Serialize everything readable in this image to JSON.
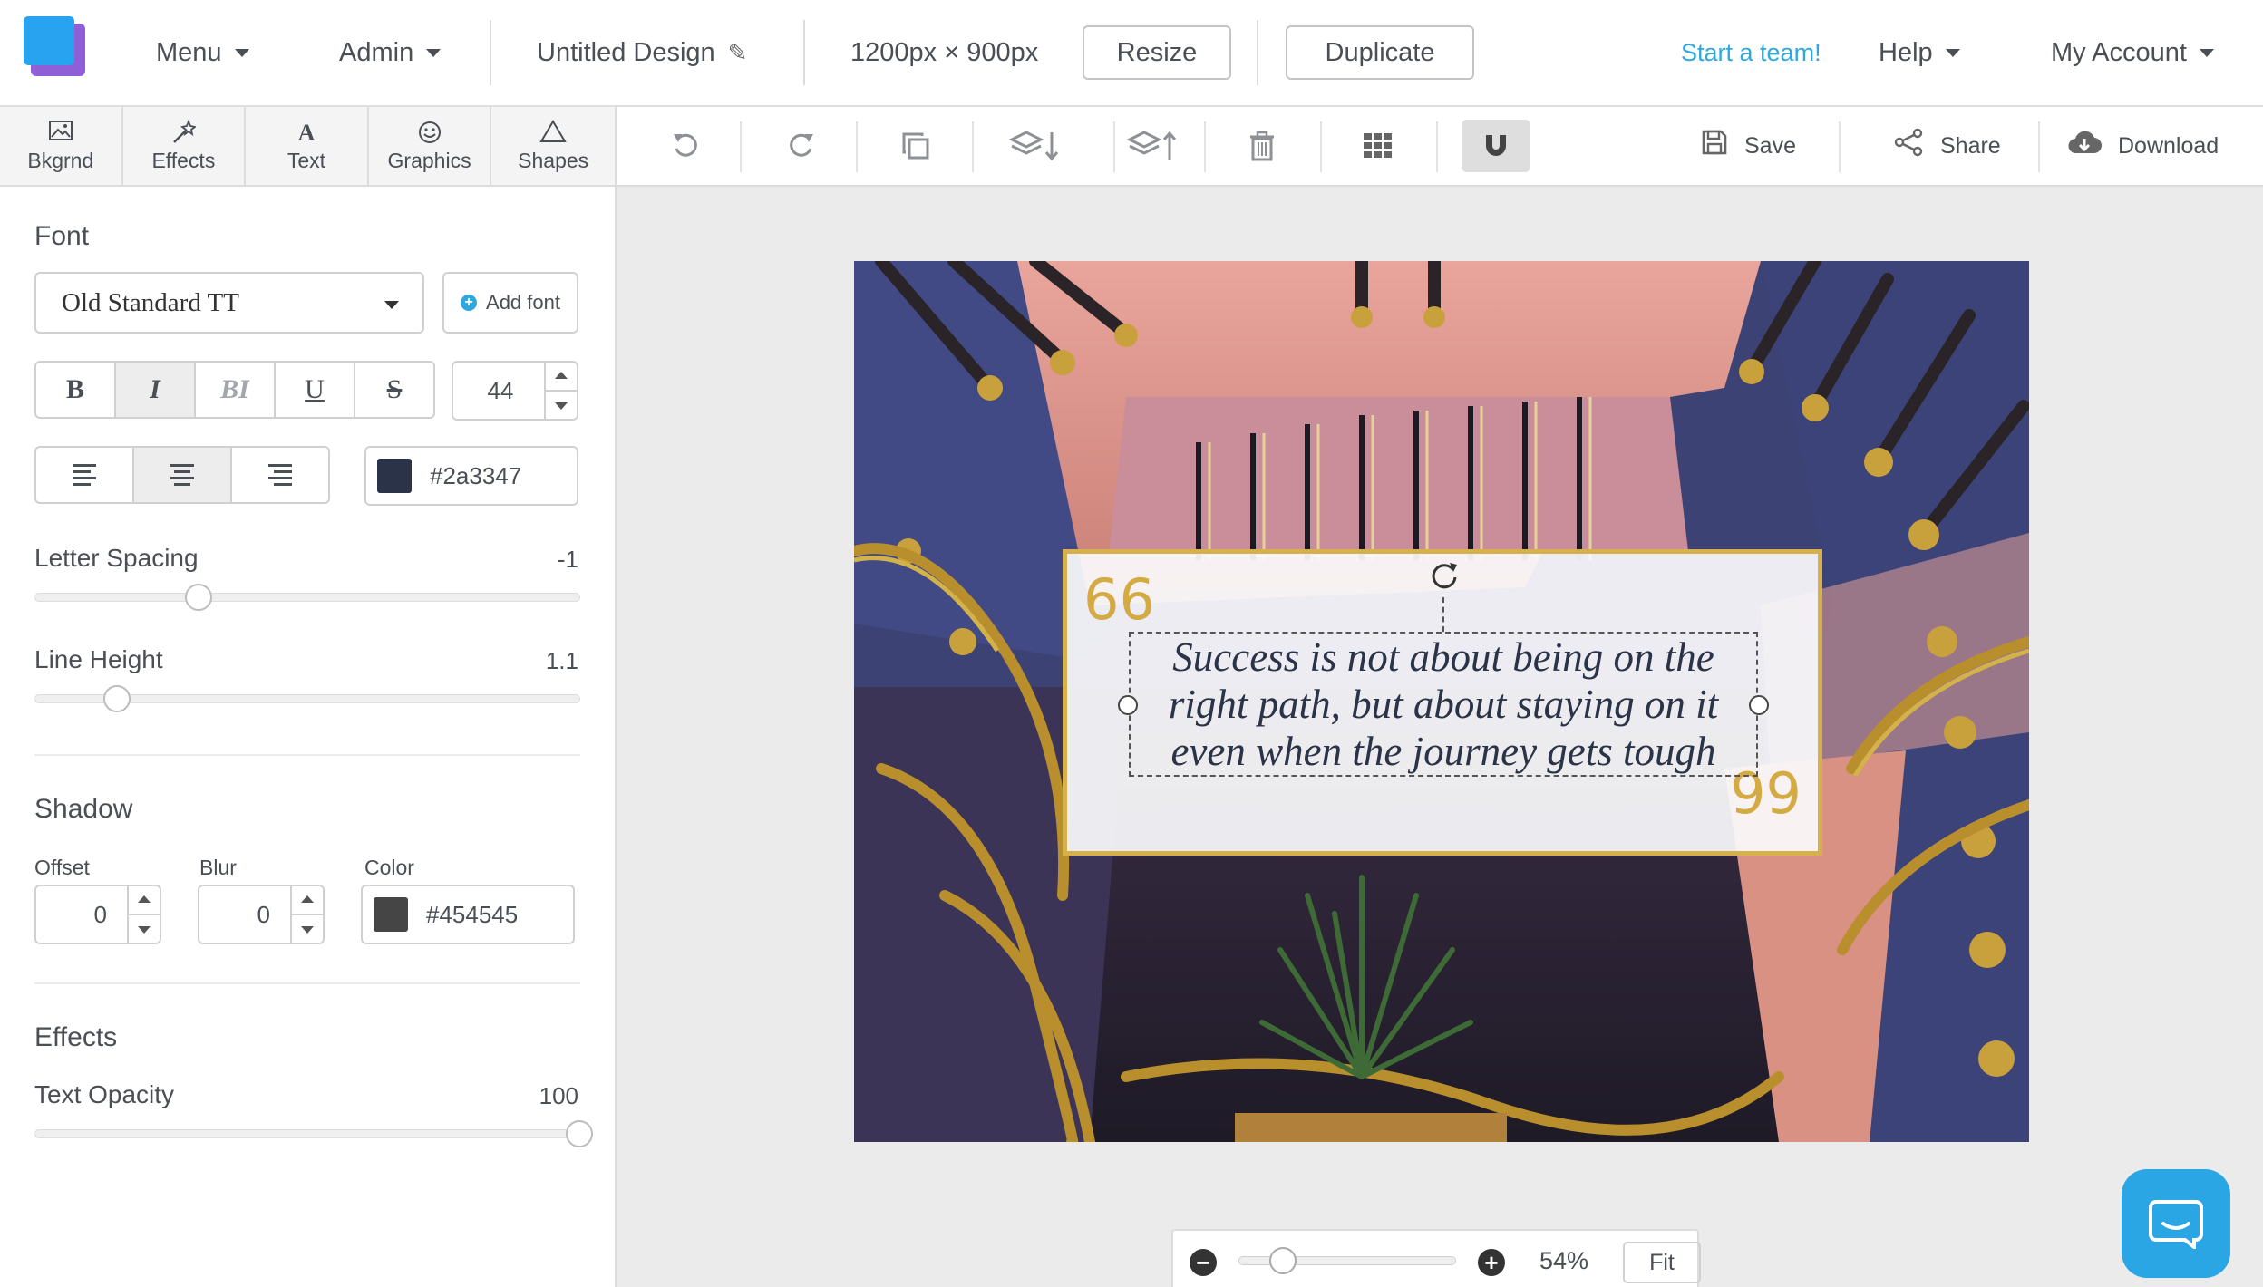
{
  "header": {
    "menu_label": "Menu",
    "admin_label": "Admin",
    "design_title": "Untitled Design",
    "dimensions": "1200px × 900px",
    "resize_label": "Resize",
    "duplicate_label": "Duplicate",
    "team_link": "Start a team!",
    "help_label": "Help",
    "account_label": "My Account"
  },
  "tool_tabs": [
    {
      "label": "Bkgrnd",
      "icon": "image-icon"
    },
    {
      "label": "Effects",
      "icon": "magic-wand-icon"
    },
    {
      "label": "Text",
      "icon": "text-icon",
      "glyph": "A"
    },
    {
      "label": "Graphics",
      "icon": "smiley-icon"
    },
    {
      "label": "Shapes",
      "icon": "triangle-icon"
    }
  ],
  "toolbar": {
    "save_label": "Save",
    "share_label": "Share",
    "download_label": "Download"
  },
  "font_panel": {
    "font_title": "Font",
    "font_family": "Old Standard TT",
    "add_font_label": "Add font",
    "style_buttons": [
      "B",
      "I",
      "BI",
      "U",
      "S"
    ],
    "font_size": "44",
    "text_color": "#2a3347",
    "letter_spacing_label": "Letter Spacing",
    "letter_spacing_value": "-1",
    "letter_spacing_fraction": 0.3,
    "line_height_label": "Line Height",
    "line_height_value": "1.1",
    "line_height_fraction": 0.15,
    "shadow_title": "Shadow",
    "shadow_offset_label": "Offset",
    "shadow_offset": "0",
    "shadow_blur_label": "Blur",
    "shadow_blur": "0",
    "shadow_color_label": "Color",
    "shadow_color": "#454545",
    "effects_title": "Effects",
    "text_opacity_label": "Text Opacity",
    "text_opacity_value": "100",
    "text_opacity_fraction": 1.0
  },
  "canvas": {
    "quote_text": "Success is not about being on the right path, but about staying on it even when the journey gets tough",
    "quote_open": "66",
    "quote_close": "99",
    "frame_color": "#d6b04a"
  },
  "zoom": {
    "percent": "54%",
    "fit_label": "Fit",
    "fraction": 0.2
  },
  "colors": {
    "accent": "#2ea8dd",
    "chat": "#2aa6e5"
  }
}
